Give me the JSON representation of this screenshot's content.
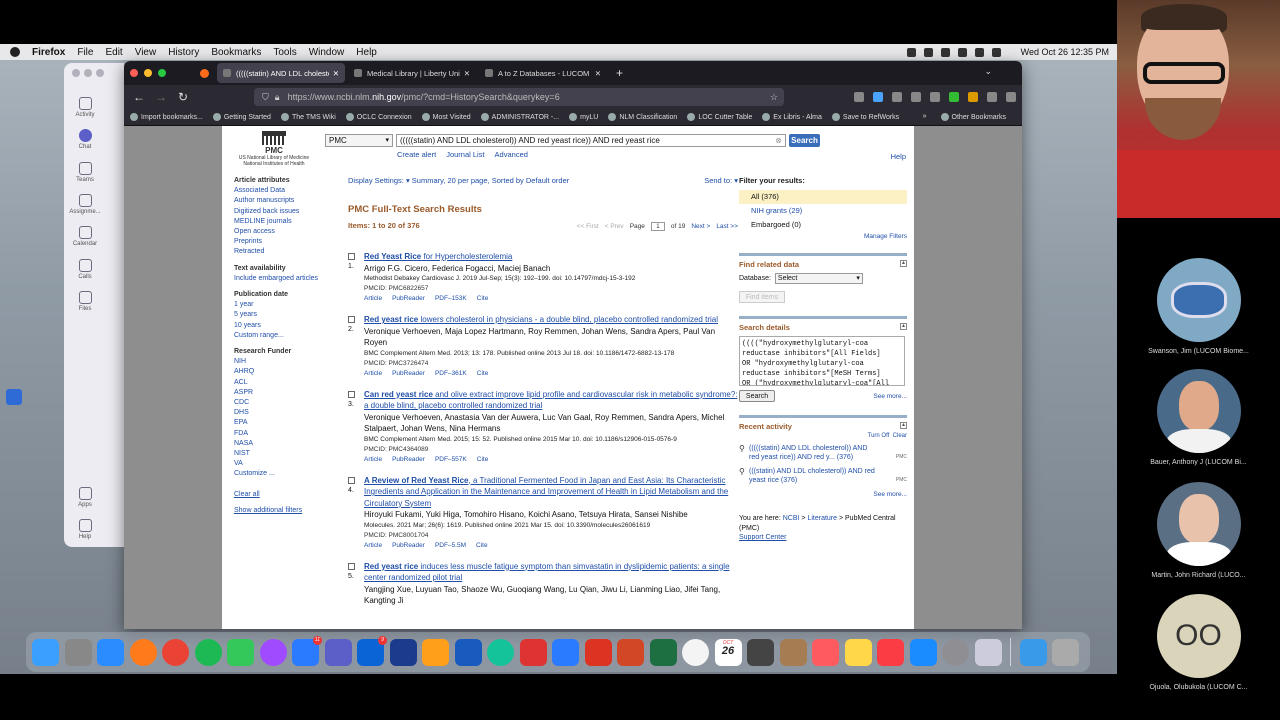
{
  "menubar": {
    "app": "Firefox",
    "items": [
      "File",
      "Edit",
      "View",
      "History",
      "Bookmarks",
      "Tools",
      "Window",
      "Help"
    ],
    "clock": "Wed Oct 26  12:35 PM"
  },
  "teams": {
    "nav": [
      "Activity",
      "Chat",
      "Teams",
      "Assignme...",
      "Calendar",
      "Calls",
      "Files",
      "Apps",
      "Help"
    ]
  },
  "browser": {
    "tabs": [
      {
        "title": "(((((statin) AND LDL cholesterol",
        "active": true
      },
      {
        "title": "Medical Library | Liberty Univer",
        "active": false
      },
      {
        "title": "A to Z Databases - LUCOM Libr",
        "active": false
      }
    ],
    "url_prefix": "https://www.ncbi.nlm.",
    "url_domain": "nih.gov",
    "url_path": "/pmc/?cmd=HistorySearch&querykey=6",
    "bookmarks": [
      "Import bookmarks...",
      "Getting Started",
      "The TMS Wiki",
      "OCLC Connexion",
      "Most Visited",
      "ADMINISTRATOR -...",
      "myLU",
      "NLM Classification",
      "LOC Cutter Table",
      "Ex Libris - Alma",
      "Save to RefWorks"
    ],
    "other_bookmarks": "Other Bookmarks"
  },
  "pmc": {
    "logo_text": "PMC",
    "logo_sub1": "US National Library of Medicine",
    "logo_sub2": "National Institutes of Health",
    "db_value": "PMC",
    "query": "(((((statin) AND LDL cholesterol)) AND red yeast rice)) AND red yeast rice",
    "search_label": "Search",
    "sublinks": [
      "Create alert",
      "Journal List",
      "Advanced"
    ],
    "help": "Help",
    "display_settings": "Display Settings:",
    "display_value": "Summary, 20 per page, Sorted by Default order",
    "send_to": "Send to:",
    "results_title": "PMC Full-Text Search Results",
    "items_count": "Items: 1 to 20 of 376",
    "pager": {
      "first": "<< First",
      "prev": "< Prev",
      "page_label": "Page",
      "page": "1",
      "of": "of 19",
      "next": "Next >",
      "last": "Last >>"
    }
  },
  "left_filters": {
    "article_attributes": {
      "heading": "Article attributes",
      "items": [
        "Associated Data",
        "Author manuscripts",
        "Digitized back issues",
        "MEDLINE journals",
        "Open access",
        "Preprints",
        "Retracted"
      ]
    },
    "text_availability": {
      "heading": "Text availability",
      "items": [
        "Include embargoed articles"
      ]
    },
    "publication_date": {
      "heading": "Publication date",
      "items": [
        "1 year",
        "5 years",
        "10 years",
        "Custom range..."
      ]
    },
    "research_funder": {
      "heading": "Research Funder",
      "items": [
        "NIH",
        "AHRQ",
        "ACL",
        "ASPR",
        "CDC",
        "DHS",
        "EPA",
        "FDA",
        "NASA",
        "NIST",
        "VA",
        "Customize ..."
      ]
    },
    "clear_all": "Clear all",
    "show_additional": "Show additional filters"
  },
  "results": [
    {
      "num": "1.",
      "title_b": "Red Yeast Rice",
      "title_rest": " for Hypercholesterolemia",
      "authors": "Arrigo F.G. Cicero, Federica Fogacci, Maciej Banach",
      "journal": "Methodist Debakey Cardiovasc J. 2019 Jul-Sep; 15(3): 192–199. doi: 10.14797/mdcj-15-3-192",
      "pmcid": "PMCID: PMC6822657",
      "links": [
        "Article",
        "PubReader",
        "PDF–153K",
        "Cite"
      ]
    },
    {
      "num": "2.",
      "title_b": "Red yeast rice",
      "title_rest": " lowers cholesterol in physicians - a double blind, placebo controlled randomized trial",
      "authors": "Veronique Verhoeven, Maja Lopez Hartmann, Roy Remmen, Johan Wens, Sandra Apers, Paul Van Royen",
      "journal": "BMC Complement Altern Med. 2013; 13: 178. Published online 2013 Jul 18. doi: 10.1186/1472-6882-13-178",
      "pmcid": "PMCID: PMC3726474",
      "links": [
        "Article",
        "PubReader",
        "PDF–361K",
        "Cite"
      ]
    },
    {
      "num": "3.",
      "title_b": "Can red yeast rice",
      "title_rest": " and olive extract improve lipid profile and cardiovascular risk in metabolic syndrome?: a double blind, placebo controlled randomized trial",
      "authors": "Veronique Verhoeven, Anastasia Van der Auwera, Luc Van Gaal, Roy Remmen, Sandra Apers, Michel Stalpaert, Johan Wens, Nina Hermans",
      "journal": "BMC Complement Altern Med. 2015; 15: 52. Published online 2015 Mar 10. doi: 10.1186/s12906-015-0576-9",
      "pmcid": "PMCID: PMC4364089",
      "links": [
        "Article",
        "PubReader",
        "PDF–557K",
        "Cite"
      ]
    },
    {
      "num": "4.",
      "title_b": "A Review of Red Yeast Rice",
      "title_rest": ", a Traditional Fermented Food in Japan and East Asia: Its Characteristic Ingredients and Application in the Maintenance and Improvement of Health in Lipid Metabolism and the Circulatory System",
      "authors": "Hiroyuki Fukami, Yuki Higa, Tomohiro Hisano, Koichi Asano, Tetsuya Hirata, Sansei Nishibe",
      "journal": "Molecules. 2021 Mar; 26(6): 1619. Published online 2021 Mar 15. doi: 10.3390/molecules26061619",
      "pmcid": "PMCID: PMC8001704",
      "links": [
        "Article",
        "PubReader",
        "PDF–5.5M",
        "Cite"
      ]
    },
    {
      "num": "5.",
      "title_b": "Red yeast rice",
      "title_rest": " induces less muscle fatigue symptom than simvastatin in dyslipidemic patients: a single center randomized pilot trial",
      "authors": "Yangjing Xue, Luyuan Tao, Shaoze Wu, Guoqiang Wang, Lu Qian, Jiwu Li, Lianming Liao, Jifei Tang, Kangting Ji",
      "journal": "",
      "pmcid": "",
      "links": []
    }
  ],
  "right": {
    "filter_heading": "Filter your results:",
    "filters": [
      {
        "label": "All (376)",
        "selected": true
      },
      {
        "label": "NIH grants (29)",
        "selected": false
      },
      {
        "label": "Embargoed (0)",
        "selected": false
      }
    ],
    "manage_filters": "Manage Filters",
    "find_related": "Find related data",
    "database_label": "Database:",
    "database_value": "Select",
    "find_items": "Find items",
    "search_details": "Search details",
    "search_details_text": "((((\"hydroxymethylglutaryl-coa\nreductase inhibitors\"[All Fields]\nOR \"hydroxymethylglutaryl-coa\nreductase inhibitors\"[MeSH Terms]\nOR (\"hydroxymethylglutaryl-coa\"[All",
    "search_btn": "Search",
    "see_more": "See more...",
    "recent_activity": "Recent activity",
    "turn_off": "Turn Off",
    "clear": "Clear",
    "recent": [
      {
        "text": "(((((statin) AND LDL cholesterol)) AND red yeast rice)) AND red y... (376)",
        "db": "PMC"
      },
      {
        "text": "(((statin) AND LDL cholesterol)) AND red yeast rice (376)",
        "db": "PMC"
      }
    ],
    "see_more2": "See more...",
    "you_are_here": "You are here: ",
    "crumbs": [
      "NCBI",
      "Literature",
      "PubMed Central (PMC)"
    ],
    "support": "Support Center"
  },
  "participants": [
    {
      "name": "Swanson, Jim (LUCOM Biome...",
      "type": "image",
      "color": "#7fa9c4"
    },
    {
      "name": "Bauer, Anthony J (LUCOM Bi...",
      "type": "photo",
      "color": "#4a6a8a"
    },
    {
      "name": "Martin, John Richard (LUCO...",
      "type": "photo",
      "color": "#5a6e84"
    },
    {
      "name": "Ojuola, Olubukola (LUCOM C...",
      "type": "initials",
      "initials": "OO",
      "color": "#d9d4ba"
    }
  ],
  "dock": {
    "calendar_month": "OCT",
    "calendar_day": "26",
    "mail_badge": "11",
    "outlook_badge": "9"
  }
}
